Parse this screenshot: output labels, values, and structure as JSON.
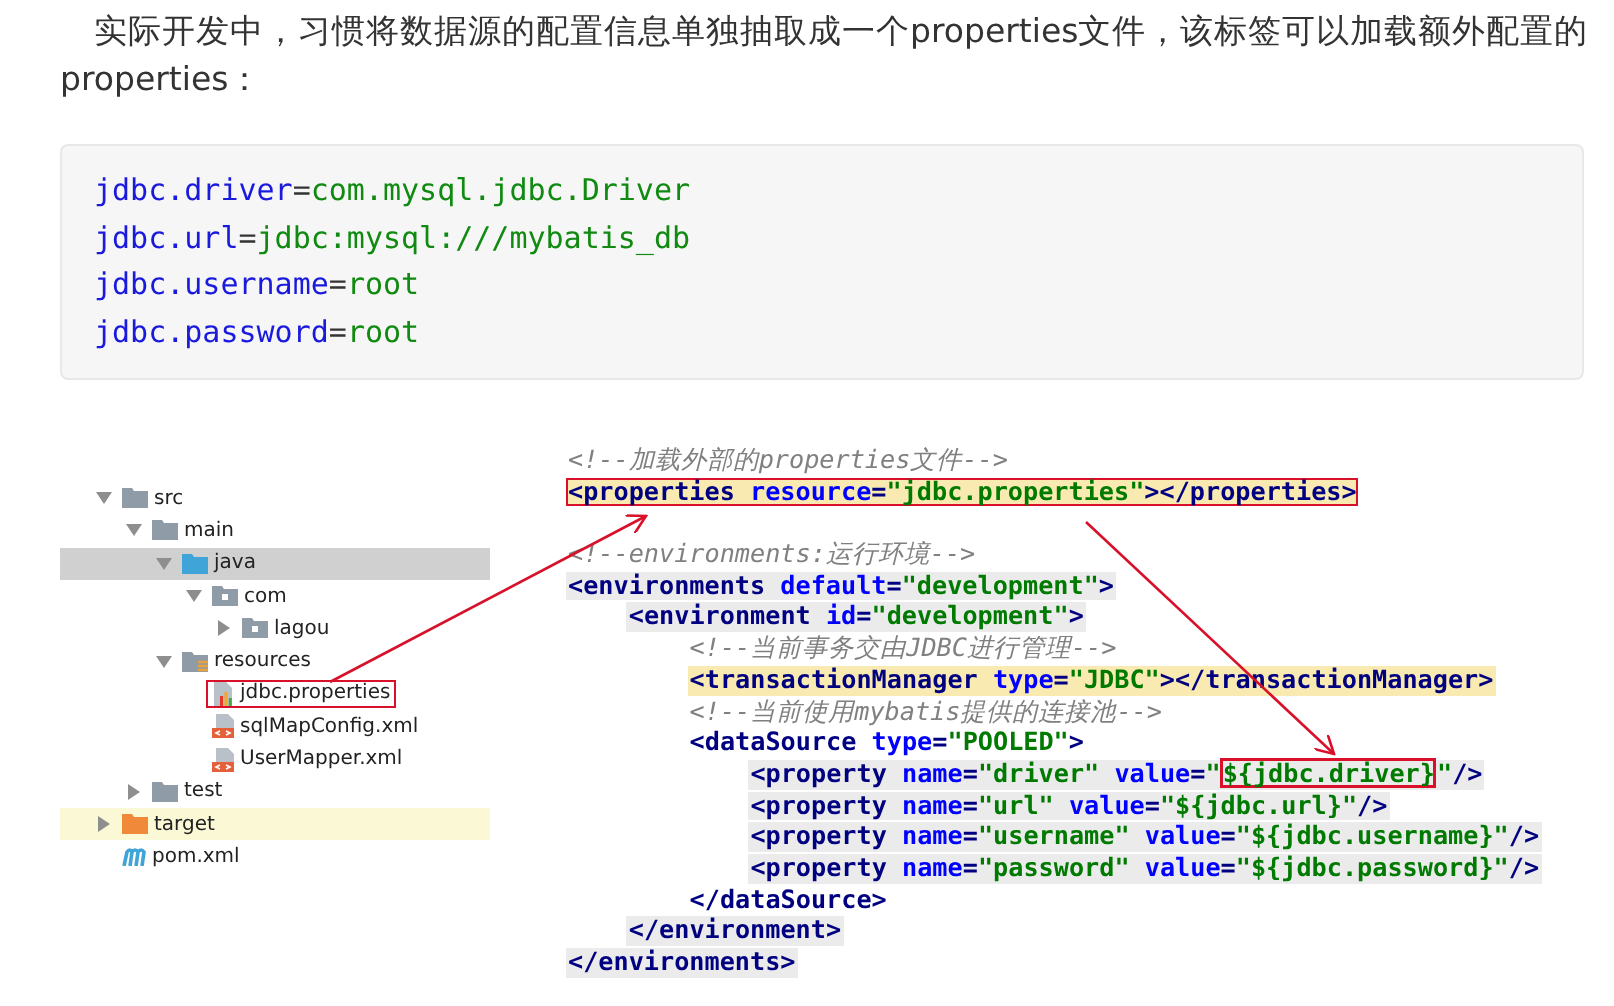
{
  "paragraph": "实际开发中，习惯将数据源的配置信息单独抽取成一个properties文件，该标签可以加载额外配置的properties：",
  "properties_code": [
    {
      "key": "jdbc.driver",
      "sep": "=",
      "value": "com.mysql.jdbc.Driver"
    },
    {
      "key": "jdbc.url",
      "sep": "=",
      "value": "jdbc:mysql:///mybatis_db"
    },
    {
      "key": "jdbc.username",
      "sep": "=",
      "value": "root"
    },
    {
      "key": "jdbc.password",
      "sep": "=",
      "value": "root"
    }
  ],
  "figure": {
    "project_tree": [
      {
        "label": "src",
        "kind": "folder",
        "expanded": true,
        "selected": false,
        "excluded": false,
        "boxed": false,
        "children": [
          {
            "label": "main",
            "kind": "folder",
            "expanded": true,
            "selected": false,
            "excluded": false,
            "boxed": false,
            "children": [
              {
                "label": "java",
                "kind": "source-folder",
                "expanded": true,
                "selected": true,
                "excluded": false,
                "boxed": false,
                "children": [
                  {
                    "label": "com",
                    "kind": "package",
                    "expanded": true,
                    "selected": false,
                    "excluded": false,
                    "boxed": false,
                    "children": [
                      {
                        "label": "lagou",
                        "kind": "package",
                        "expanded": false,
                        "selected": false,
                        "excluded": false,
                        "boxed": false
                      }
                    ]
                  }
                ]
              },
              {
                "label": "resources",
                "kind": "resources-folder",
                "expanded": true,
                "selected": false,
                "excluded": false,
                "boxed": false,
                "children": [
                  {
                    "label": "jdbc.properties",
                    "kind": "properties-file",
                    "selected": false,
                    "excluded": false,
                    "boxed": true
                  },
                  {
                    "label": "sqlMapConfig.xml",
                    "kind": "xml-file",
                    "selected": false,
                    "excluded": false,
                    "boxed": false
                  },
                  {
                    "label": "UserMapper.xml",
                    "kind": "xml-file",
                    "selected": false,
                    "excluded": false,
                    "boxed": false
                  }
                ]
              }
            ]
          },
          {
            "label": "test",
            "kind": "folder",
            "expanded": false,
            "selected": false,
            "excluded": false,
            "boxed": false
          }
        ]
      },
      {
        "label": "target",
        "kind": "excluded-folder",
        "expanded": false,
        "selected": false,
        "excluded": true,
        "boxed": false
      },
      {
        "label": "pom.xml",
        "kind": "maven-file",
        "selected": false,
        "excluded": false,
        "boxed": false
      }
    ],
    "xml_code": [
      {
        "kind": "plain",
        "tokens": [
          {
            "kind": "comment",
            "text": "<!--加载外部的properties文件-->"
          }
        ]
      },
      {
        "kind": "match",
        "boxed": true,
        "tokens": [
          {
            "kind": "tag",
            "text": "<properties "
          },
          {
            "kind": "attr",
            "text": "resource"
          },
          {
            "kind": "tag",
            "text": "="
          },
          {
            "kind": "value",
            "text": "\"jdbc.properties\""
          },
          {
            "kind": "tag",
            "text": "></properties>"
          }
        ]
      },
      {
        "kind": "plain",
        "gap_before": true,
        "tokens": [
          {
            "kind": "comment",
            "text": "<!--environments:运行环境-->"
          }
        ]
      },
      {
        "kind": "scope",
        "tokens": [
          {
            "kind": "tag",
            "text": "<environments "
          },
          {
            "kind": "attr",
            "text": "default"
          },
          {
            "kind": "tag",
            "text": "="
          },
          {
            "kind": "value",
            "text": "\"development\""
          },
          {
            "kind": "tag",
            "text": ">"
          }
        ],
        "children": [
          {
            "kind": "scope",
            "tokens": [
              {
                "kind": "tag",
                "text": "<environment "
              },
              {
                "kind": "attr",
                "text": "id"
              },
              {
                "kind": "tag",
                "text": "="
              },
              {
                "kind": "value",
                "text": "\"development\""
              },
              {
                "kind": "tag",
                "text": ">"
              }
            ],
            "children": [
              {
                "kind": "plain",
                "tokens": [
                  {
                    "kind": "comment",
                    "text": "<!--当前事务交由JDBC进行管理-->"
                  }
                ]
              },
              {
                "kind": "match",
                "tokens": [
                  {
                    "kind": "tag",
                    "text": "<transactionManager "
                  },
                  {
                    "kind": "attr",
                    "text": "type"
                  },
                  {
                    "kind": "tag",
                    "text": "="
                  },
                  {
                    "kind": "value",
                    "text": "\"JDBC\""
                  },
                  {
                    "kind": "tag",
                    "text": "></transactionManager>"
                  }
                ]
              },
              {
                "kind": "plain",
                "tokens": [
                  {
                    "kind": "comment",
                    "text": "<!--当前使用mybatis提供的连接池-->"
                  }
                ]
              },
              {
                "kind": "plain",
                "tokens": [
                  {
                    "kind": "tag",
                    "text": "<dataSource "
                  },
                  {
                    "kind": "attr",
                    "text": "type"
                  },
                  {
                    "kind": "tag",
                    "text": "="
                  },
                  {
                    "kind": "value",
                    "text": "\"POOLED\""
                  },
                  {
                    "kind": "tag",
                    "text": ">"
                  }
                ],
                "children": [
                  {
                    "kind": "scope",
                    "tokens": [
                      {
                        "kind": "tag",
                        "text": "<property "
                      },
                      {
                        "kind": "attr",
                        "text": "name"
                      },
                      {
                        "kind": "tag",
                        "text": "="
                      },
                      {
                        "kind": "value",
                        "text": "\"driver\" "
                      },
                      {
                        "kind": "attr",
                        "text": "value"
                      },
                      {
                        "kind": "tag",
                        "text": "="
                      },
                      {
                        "kind": "value",
                        "text": "\""
                      },
                      {
                        "kind": "value",
                        "text": "${jdbc.driver}",
                        "boxed": true
                      },
                      {
                        "kind": "value",
                        "text": "\""
                      },
                      {
                        "kind": "tag",
                        "text": "/>"
                      }
                    ]
                  },
                  {
                    "kind": "scope",
                    "tokens": [
                      {
                        "kind": "tag",
                        "text": "<property "
                      },
                      {
                        "kind": "attr",
                        "text": "name"
                      },
                      {
                        "kind": "tag",
                        "text": "="
                      },
                      {
                        "kind": "value",
                        "text": "\"url\" "
                      },
                      {
                        "kind": "attr",
                        "text": "value"
                      },
                      {
                        "kind": "tag",
                        "text": "="
                      },
                      {
                        "kind": "value",
                        "text": "\"${jdbc.url}\""
                      },
                      {
                        "kind": "tag",
                        "text": "/>"
                      }
                    ]
                  },
                  {
                    "kind": "scope",
                    "tokens": [
                      {
                        "kind": "tag",
                        "text": "<property "
                      },
                      {
                        "kind": "attr",
                        "text": "name"
                      },
                      {
                        "kind": "tag",
                        "text": "="
                      },
                      {
                        "kind": "value",
                        "text": "\"username\" "
                      },
                      {
                        "kind": "attr",
                        "text": "value"
                      },
                      {
                        "kind": "tag",
                        "text": "="
                      },
                      {
                        "kind": "value",
                        "text": "\"${jdbc.username}\""
                      },
                      {
                        "kind": "tag",
                        "text": "/>"
                      }
                    ]
                  },
                  {
                    "kind": "scope",
                    "tokens": [
                      {
                        "kind": "tag",
                        "text": "<property "
                      },
                      {
                        "kind": "attr",
                        "text": "name"
                      },
                      {
                        "kind": "tag",
                        "text": "="
                      },
                      {
                        "kind": "value",
                        "text": "\"password\" "
                      },
                      {
                        "kind": "attr",
                        "text": "value"
                      },
                      {
                        "kind": "tag",
                        "text": "="
                      },
                      {
                        "kind": "value",
                        "text": "\"${jdbc.password}\""
                      },
                      {
                        "kind": "tag",
                        "text": "/>"
                      }
                    ]
                  }
                ],
                "close": {
                  "kind": "plain",
                  "tokens": [
                    {
                      "kind": "tag",
                      "text": "</dataSource>"
                    }
                  ]
                }
              }
            ],
            "close": {
              "kind": "scope",
              "tokens": [
                {
                  "kind": "tag",
                  "text": "</environment>"
                }
              ]
            }
          }
        ],
        "close": {
          "kind": "scope",
          "tokens": [
            {
              "kind": "tag",
              "text": "</environments>"
            }
          ]
        }
      }
    ]
  }
}
